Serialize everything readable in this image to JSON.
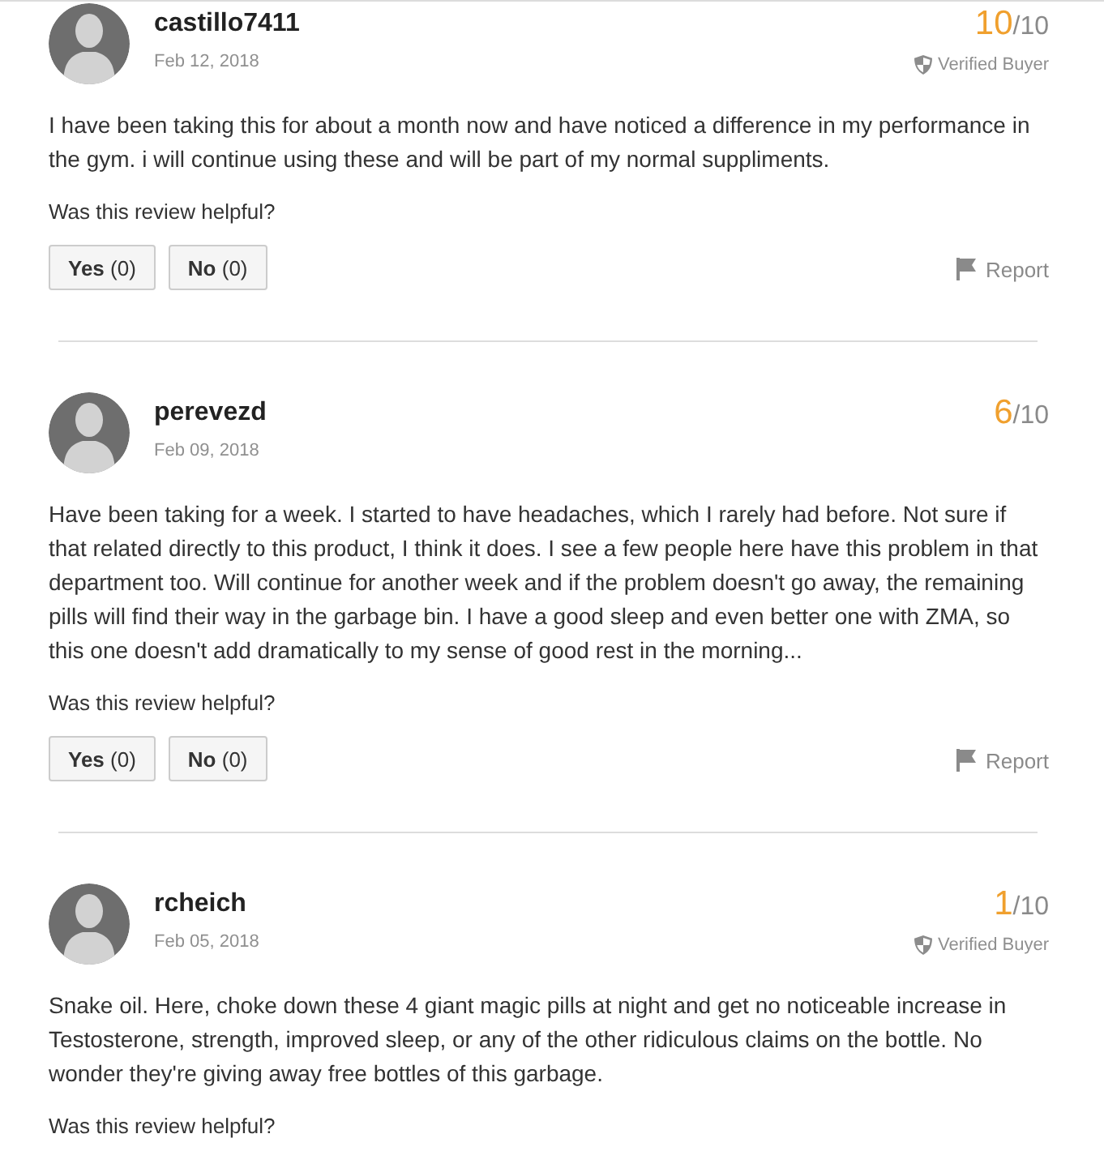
{
  "reviews": [
    {
      "username": "castillo7411",
      "date": "Feb 12, 2018",
      "score": "10",
      "score_max": "/10",
      "badge": "Verified Buyer",
      "text": "I have been taking this for about a month now and have noticed a difference in my performance in the gym. i will continue using these and will be part of my normal suppliments.",
      "helpful_prompt": "Was this review helpful?",
      "votes": [
        "**Yes** (0)",
        "**No** (0)"
      ],
      "report": "Report"
    },
    {
      "username": "perevezd",
      "date": "Feb 09, 2018",
      "score": "6",
      "score_max": "/10",
      "text": "Have been taking for a week. I started to have headaches, which I rarely had before. Not sure if that related directly to this product, I think it does. I see a few people here have this problem in that department too. Will continue for another week and if the problem doesn't go away, the remaining pills will find their way in the garbage bin. I have a good sleep and even better one with ZMA, so this one doesn't add dramatically to my sense of good rest in the morning...",
      "helpful_prompt": "Was this review helpful?",
      "votes": [
        "**Yes** (0)",
        "**No** (0)"
      ],
      "report": "Report"
    },
    {
      "username": "rcheich",
      "date": "Feb 05, 2018",
      "score": "1",
      "score_max": "/10",
      "badge": "Verified Buyer",
      "text": "Snake oil. Here, choke down these 4 giant magic pills at night and get no noticeable increase in Testosterone, strength, improved sleep, or any of the other ridiculous claims on the bottle. No wonder they're giving away free bottles of this garbage.",
      "helpful_prompt": "Was this review helpful?"
    }
  ]
}
